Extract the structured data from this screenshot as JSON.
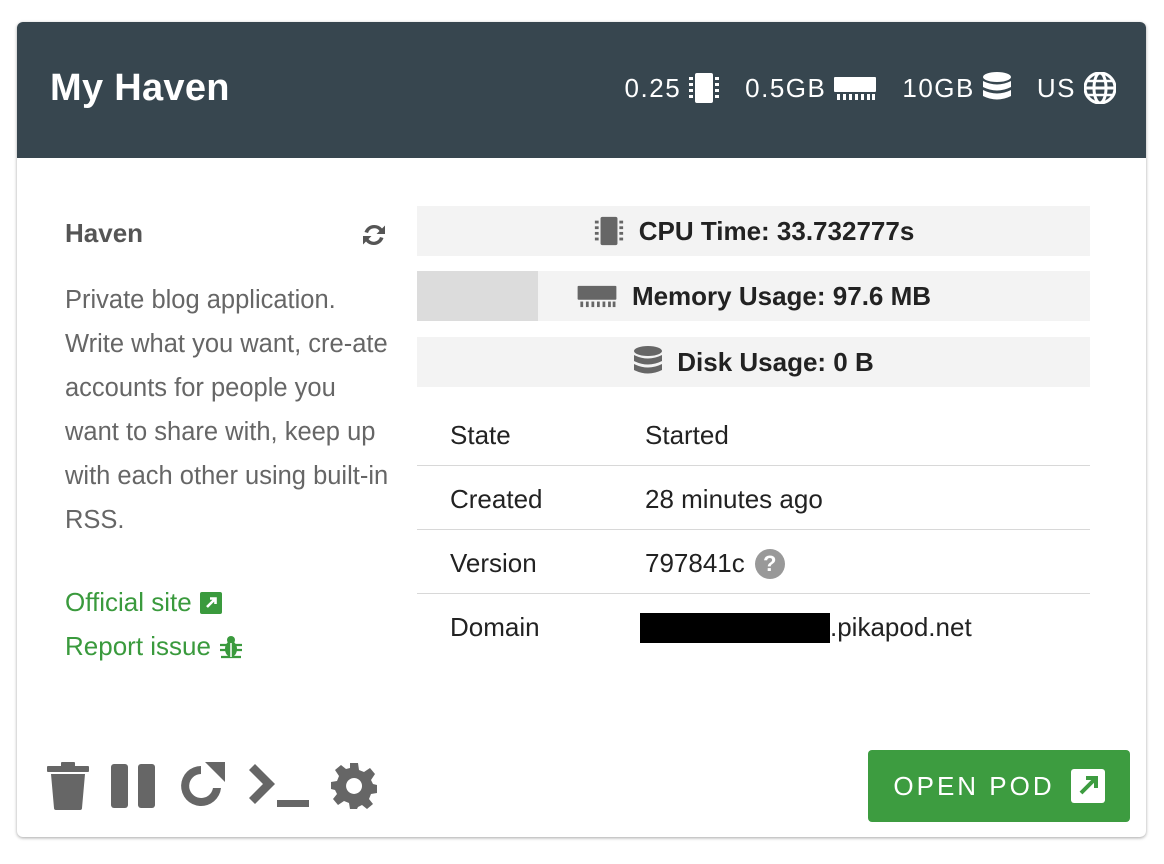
{
  "header": {
    "title": "My Haven",
    "specs": [
      {
        "value": "0.25",
        "icon": "cpu-chip-icon"
      },
      {
        "value": "0.5GB",
        "icon": "memory-icon"
      },
      {
        "value": "10GB",
        "icon": "database-icon"
      },
      {
        "value": "US",
        "icon": "globe-icon"
      }
    ]
  },
  "app": {
    "name": "Haven",
    "description": "Private blog application. Write what you want, cre-­ate accounts for people you want to share with, keep up with each other using built-in RSS.",
    "links": {
      "official_site": "Official site",
      "report_issue": "Report issue"
    }
  },
  "stats": {
    "cpu": "CPU Time: 33.732777s",
    "memory": "Memory Usage: 97.6 MB",
    "memory_fraction": 0.18,
    "disk": "Disk Usage: 0 B"
  },
  "info": {
    "rows": [
      {
        "key": "State",
        "value": "Started"
      },
      {
        "key": "Created",
        "value": "28 minutes ago"
      },
      {
        "key": "Version",
        "value": "797841c"
      },
      {
        "key": "Domain",
        "value": ".pikapod.net"
      }
    ],
    "help_glyph": "?"
  },
  "open_button": "OPEN POD",
  "colors": {
    "header_bg": "#37464f",
    "accent_green": "#3d9c40",
    "link_green": "#3a9a3d"
  }
}
